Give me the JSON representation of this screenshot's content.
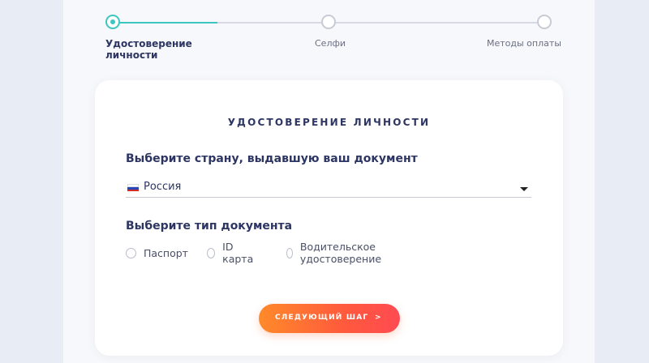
{
  "stepper": {
    "steps": [
      {
        "label_line1": "Удостоверение",
        "label_line2": "личности",
        "state": "active"
      },
      {
        "label": "Селфи",
        "state": "pending"
      },
      {
        "label": "Методы оплаты",
        "state": "pending"
      }
    ],
    "progress": 0.3
  },
  "card": {
    "title": "УДОСТОВЕРЕНИЕ ЛИЧНОСТИ",
    "country_label": "Выберите страну, выдавшую ваш документ",
    "country_value": "Россия",
    "country_flag_icon": "russia-flag-icon",
    "doc_type_label": "Выберите тип документа",
    "doc_types": [
      {
        "label": "Паспорт"
      },
      {
        "label": "ID карта"
      },
      {
        "label": "Водительское удостоверение"
      }
    ],
    "next_button": {
      "label": "СЛЕДУЮЩИЙ ШАГ",
      "arrow": ">"
    }
  },
  "colors": {
    "accent": "#3cc6c0",
    "heading": "#2d3563",
    "button_start": "#ff8a2a",
    "button_end": "#ff4a52",
    "background": "#e8edf5"
  }
}
